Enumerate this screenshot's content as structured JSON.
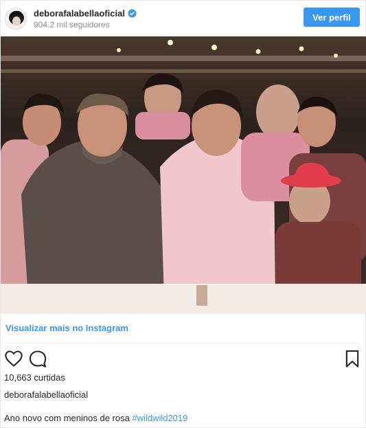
{
  "header": {
    "username": "deborafalabellaoficial",
    "followers": "904.2 mil seguidores",
    "profile_button": "Ver perfil"
  },
  "post": {
    "view_more": "Visualizar mais no Instagram",
    "likes": "10,663 curtidas",
    "caption_user": "deborafalabellaoficial",
    "caption_text": "Ano novo com meninos de rosa ",
    "caption_hashtag": "#wildwild2019"
  },
  "icons": {
    "verified": "verified-badge-icon",
    "like": "heart-icon",
    "comment": "comment-icon",
    "save": "bookmark-icon"
  },
  "colors": {
    "accent": "#3897f0",
    "text": "#262626",
    "muted": "#8e8e8e"
  }
}
